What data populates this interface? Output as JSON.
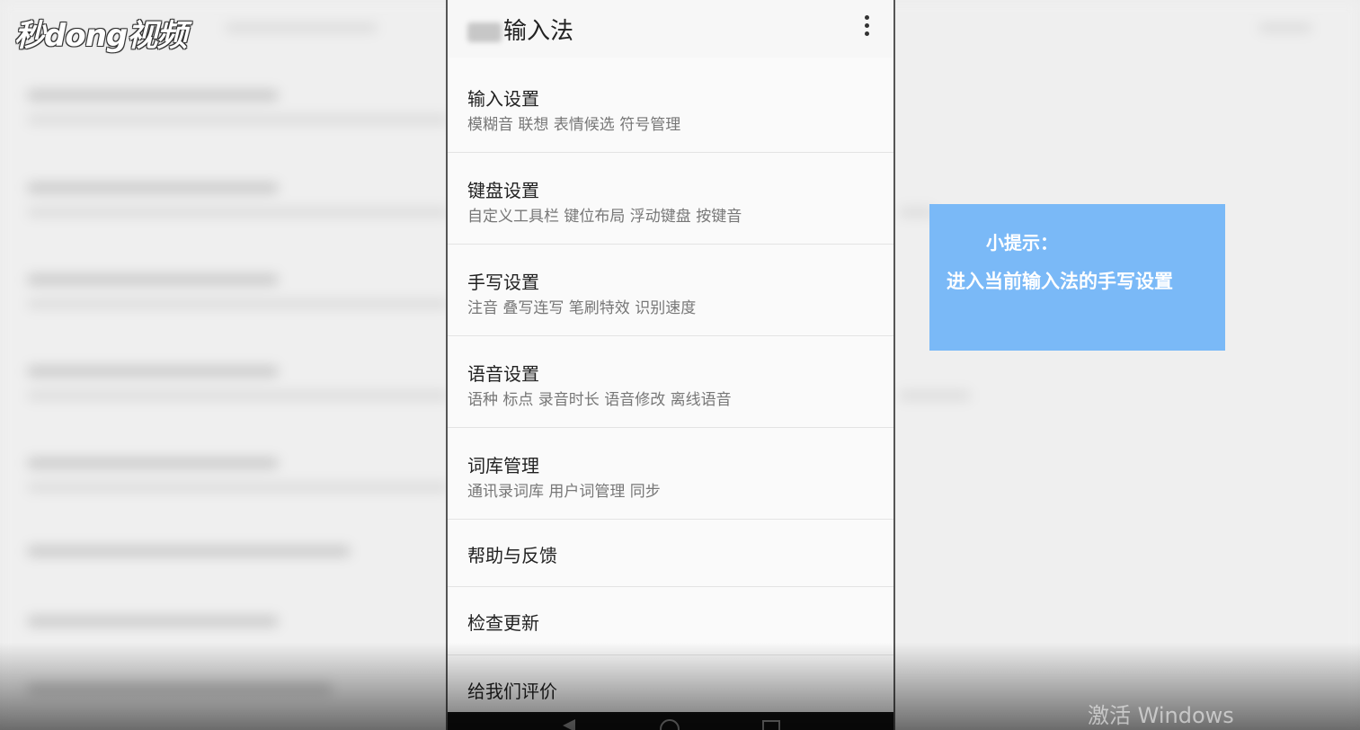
{
  "logo": {
    "text": "秒dong视频"
  },
  "app": {
    "title": "输入法",
    "menu_icon": "more-vert-icon"
  },
  "items": [
    {
      "title": "输入设置",
      "subtitle": "模糊音 联想 表情候选 符号管理"
    },
    {
      "title": "键盘设置",
      "subtitle": "自定义工具栏 键位布局 浮动键盘 按键音"
    },
    {
      "title": "手写设置",
      "subtitle": "注音 叠写连写 笔刷特效 识别速度"
    },
    {
      "title": "语音设置",
      "subtitle": "语种 标点 录音时长 语音修改 离线语音"
    },
    {
      "title": "词库管理",
      "subtitle": "通讯录词库 用户词管理 同步"
    },
    {
      "title": "帮助与反馈"
    },
    {
      "title": "检查更新"
    },
    {
      "title": "给我们评价"
    }
  ],
  "tip": {
    "title": "小提示：",
    "text": "进入当前输入法的手写设置"
  },
  "watermark": {
    "text": "激活 Windows"
  }
}
